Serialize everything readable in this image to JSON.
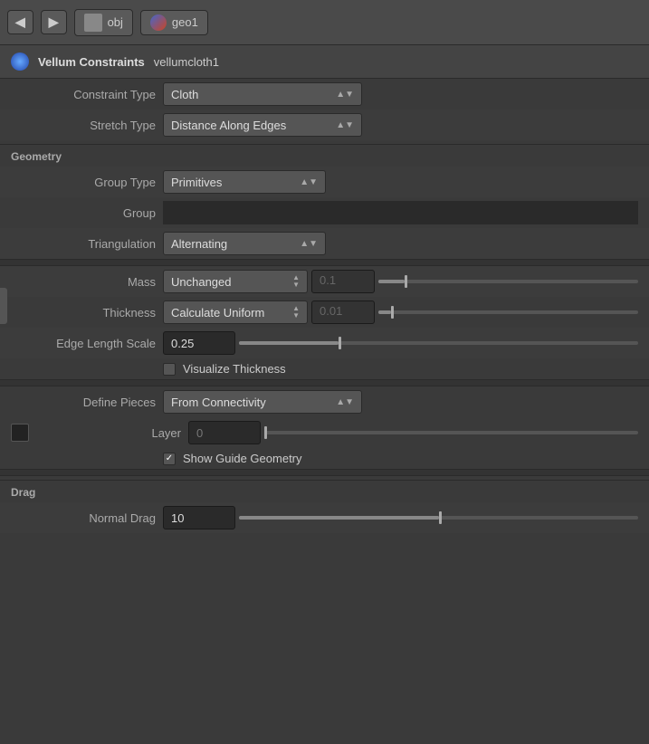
{
  "nav": {
    "back_label": "◀",
    "forward_label": "▶",
    "tab_obj_label": "obj",
    "tab_geo_label": "geo1"
  },
  "header": {
    "title": "Vellum Constraints",
    "node_name": "vellumcloth1"
  },
  "fields": {
    "constraint_type_label": "Constraint Type",
    "constraint_type_value": "Cloth",
    "stretch_type_label": "Stretch Type",
    "stretch_type_value": "Distance Along Edges",
    "geometry_section": "Geometry",
    "group_type_label": "Group Type",
    "group_type_value": "Primitives",
    "group_label": "Group",
    "group_value": "",
    "triangulation_label": "Triangulation",
    "triangulation_value": "Alternating",
    "mass_label": "Mass",
    "mass_value": "Unchanged",
    "mass_num": "0.1",
    "thickness_label": "Thickness",
    "thickness_value": "Calculate Uniform",
    "thickness_num": "0.01",
    "edge_length_scale_label": "Edge Length Scale",
    "edge_length_scale_value": "0.25",
    "visualize_thickness_label": "Visualize Thickness",
    "define_pieces_label": "Define Pieces",
    "define_pieces_value": "From Connectivity",
    "layer_label": "Layer",
    "layer_value": "0",
    "show_guide_geometry_label": "Show Guide Geometry",
    "drag_section": "Drag",
    "normal_drag_label": "Normal Drag",
    "normal_drag_value": "10"
  }
}
